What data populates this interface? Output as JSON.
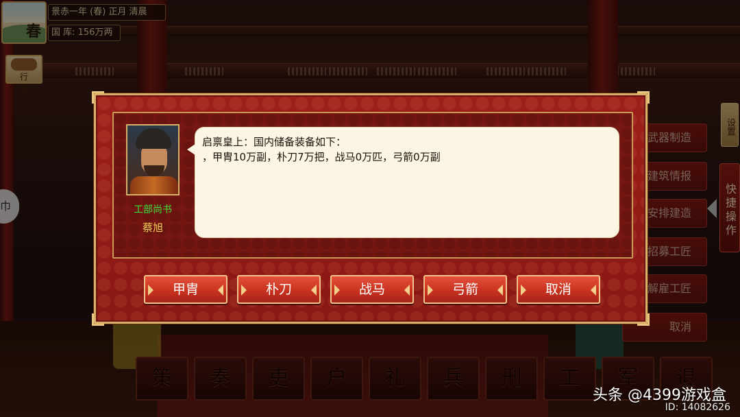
{
  "hud": {
    "season_char": "春",
    "date": "景赤一年 (春) 正月 清晨",
    "treasury": "国 库: 156万两",
    "travel_label": "行 程",
    "side_handle": "巾"
  },
  "right_menu": {
    "items": [
      "武器制造",
      "建筑情报",
      "安排建造",
      "招募工匠",
      "解雇工匠",
      "取消"
    ],
    "settings_label": "设置",
    "quick_ops_label": "快捷操作"
  },
  "ministries": [
    "策",
    "奏",
    "吏",
    "户",
    "礼",
    "兵",
    "刑",
    "工",
    "军",
    "退"
  ],
  "dialog": {
    "official_title": "工部尚书",
    "official_name": "蔡旭",
    "message_line1": "启禀皇上：国内储备装备如下：",
    "message_line2": "，甲胄10万副，朴刀7万把，战马0万匹，弓箭0万副",
    "buttons": [
      "甲胄",
      "朴刀",
      "战马",
      "弓箭",
      "取消"
    ]
  },
  "watermark": {
    "brand": "头条 @4399游戏盒",
    "id": "ID: 14082626"
  },
  "colors": {
    "dialog_red": "#8a1713",
    "gold_border": "#d8b06a",
    "button_red": "#c8321f",
    "title_green": "#3be23b",
    "name_gold": "#f2d15a"
  }
}
